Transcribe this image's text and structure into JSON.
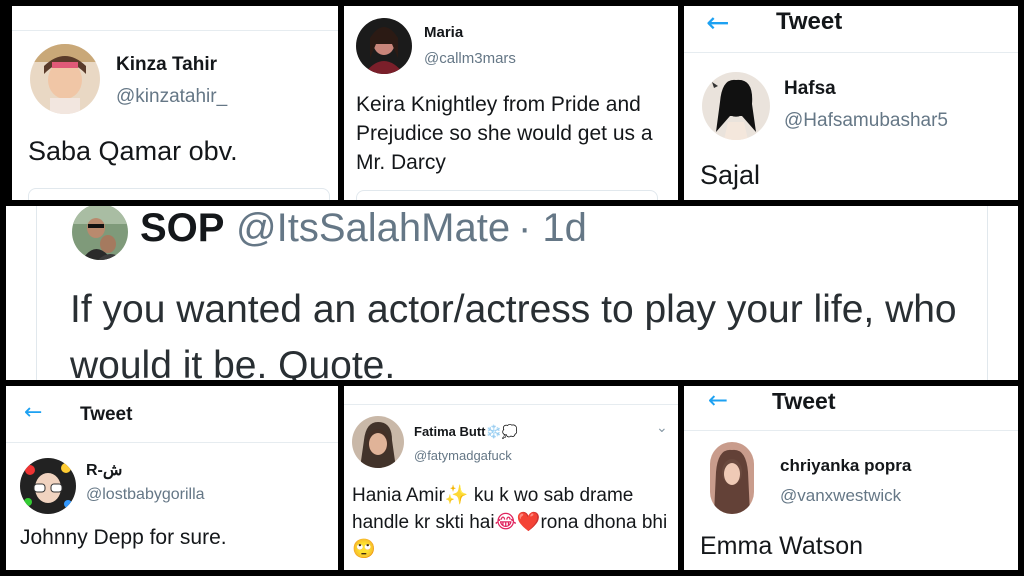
{
  "p1": {
    "name": "Kinza Tahir",
    "handle": "@kinzatahir_",
    "text": "Saba Qamar obv."
  },
  "p2": {
    "name": "Maria",
    "handle": "@callm3mars",
    "text": "Keira Knightley from Pride and Prejudice so she would get us a Mr. Darcy"
  },
  "p3": {
    "title": "Tweet",
    "name": "Hafsa",
    "handle": "@Hafsamubashar5",
    "text": "Sajal"
  },
  "p4": {
    "name": "SOP",
    "handle": "@ItsSalahMate",
    "time": "· 1d",
    "text": "If you wanted an actor/actress to play your life, who would it be. Quote."
  },
  "p5": {
    "title": "Tweet",
    "name": "R-ش",
    "handle": "@lostbabygorilla",
    "text": "Johnny Depp for sure."
  },
  "p6": {
    "name": "Fatima Butt",
    "name_emoji": "❄️💭",
    "handle": "@fatymadgafuck",
    "text_1": "Hania Amir",
    "emoji_1": "✨",
    "text_2": " ku k wo sab drame handle kr skti hai",
    "emoji_2": "😂❤️",
    "text_3": "rona dhona bhi",
    "emoji_3": "🙄"
  },
  "p7": {
    "title": "Tweet",
    "name": "chriyanka popra",
    "handle": "@vanxwestwick",
    "text": "Emma Watson"
  },
  "icons": {
    "back": "arrow-left-icon",
    "dropdown": "chevron-down-icon"
  },
  "colors": {
    "accent": "#1da1f2",
    "text": "#14171a",
    "muted": "#657786"
  }
}
